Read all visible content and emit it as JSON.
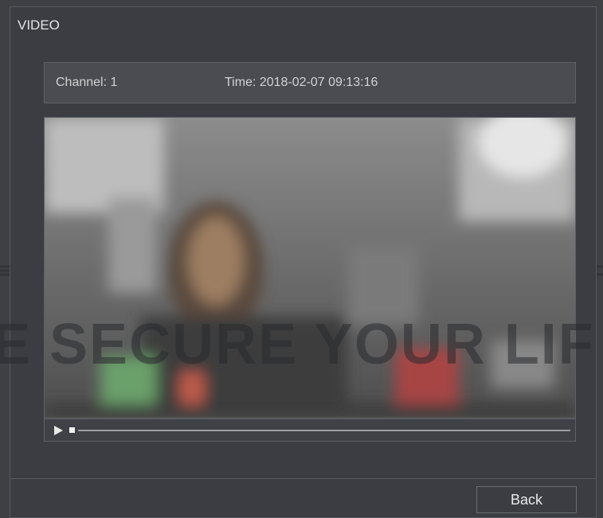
{
  "dialog": {
    "title": "VIDEO"
  },
  "info": {
    "channel_label": "Channel: 1",
    "time_label": "Time: 2018-02-07 09:13:16"
  },
  "player": {
    "play_icon": "play-icon",
    "stop_icon": "stop-icon",
    "progress_fraction": 0.0
  },
  "footer": {
    "back_label": "Back"
  },
  "watermark": {
    "text": "E SECURE YOUR LIF"
  }
}
